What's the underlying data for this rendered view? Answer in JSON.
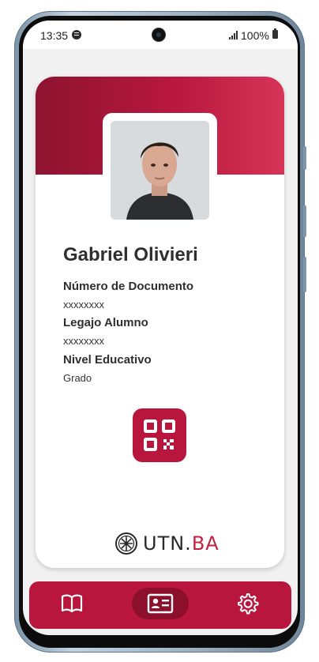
{
  "status_bar": {
    "time": "13:35",
    "battery": "100%",
    "icons": [
      "spotify-icon",
      "camera-icon",
      "signal-icon",
      "battery-icon"
    ]
  },
  "card": {
    "name": "Gabriel Olivieri",
    "fields": [
      {
        "label": "Número de Documento",
        "value": "xxxxxxxx"
      },
      {
        "label": "Legajo Alumno",
        "value": "xxxxxxxx"
      },
      {
        "label": "Nivel Educativo",
        "value": "Grado"
      }
    ],
    "qr_icon": "qr-code-icon",
    "logo": {
      "prefix": "UTN.",
      "suffix": "BA"
    }
  },
  "nav": {
    "items": [
      {
        "icon": "book-icon",
        "active": false
      },
      {
        "icon": "id-card-icon",
        "active": true
      },
      {
        "icon": "gear-icon",
        "active": false
      }
    ]
  },
  "colors": {
    "accent": "#b8163c",
    "header_start": "#8d1430",
    "header_end": "#d63457",
    "background": "#f1f1f1"
  }
}
